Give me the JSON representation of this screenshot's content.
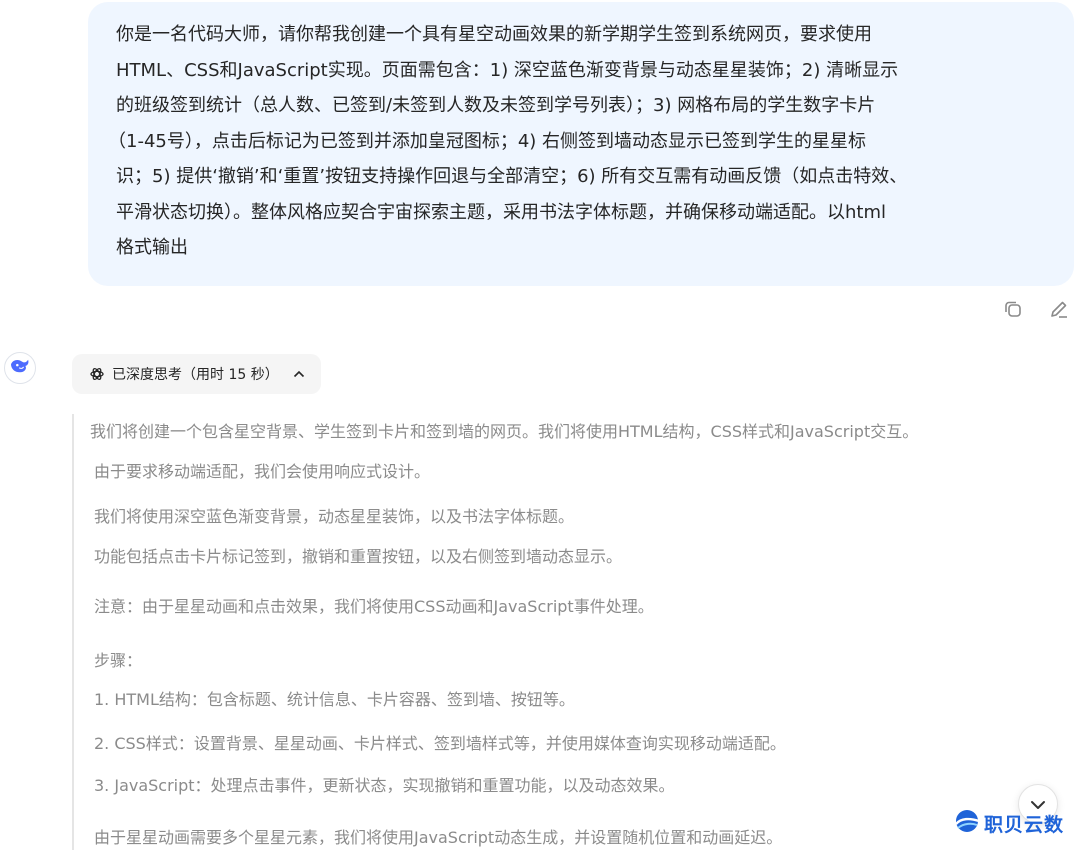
{
  "user_message": {
    "lines": [
      "你是一名代码大师，请你帮我创建一个具有星空动画效果的新学期学生签到系统网页，要求使用",
      "HTML、CSS和JavaScript实现。页面需包含：1) 深空蓝色渐变背景与动态星星装饰；2) 清晰显示",
      "的班级签到统计（总人数、已签到/未签到人数及未签到学号列表）；3) 网格布局的学生数字卡片",
      "（1-45号），点击后标记为已签到并添加皇冠图标；4) 右侧签到墙动态显示已签到学生的星星标",
      "识；5) 提供‘撤销’和‘重置’按钮支持操作回退与全部清空；6) 所有交互需有动画反馈（如点击特效、",
      "平滑状态切换）。整体风格应契合宇宙探索主题，采用书法字体标题，并确保移动端适配。以html",
      "格式输出"
    ]
  },
  "actions": {
    "copy": "copy-icon",
    "edit": "edit-icon"
  },
  "assistant": {
    "avatar_icon": "whale-logo-icon",
    "think_label": "已深度思考（用时 15 秒）",
    "reasoning": [
      "我们将创建一个包含星空背景、学生签到卡片和签到墙的网页。我们将使用HTML结构，CSS样式和JavaScript交互。",
      "由于要求移动端适配，我们会使用响应式设计。",
      "我们将使用深空蓝色渐变背景，动态星星装饰，以及书法字体标题。",
      "功能包括点击卡片标记签到，撤销和重置按钮，以及右侧签到墙动态显示。",
      "注意：由于星星动画和点击效果，我们将使用CSS动画和JavaScript事件处理。",
      "步骤：",
      "1. HTML结构：包含标题、统计信息、卡片容器、签到墙、按钮等。",
      "2. CSS样式：设置背景、星星动画、卡片样式、签到墙样式等，并使用媒体查询实现移动端适配。",
      "3. JavaScript：处理点击事件，更新状态，实现撤销和重置功能，以及动态效果。",
      "由于星星动画需要多个星星元素，我们将使用JavaScript动态生成，并设置随机位置和动画延迟。"
    ]
  },
  "watermark": {
    "text": "职贝云数"
  },
  "colors": {
    "bubble_bg": "#eff6ff",
    "brand_blue": "#4d6bfe",
    "reasoning_text": "#8b8b8b"
  }
}
